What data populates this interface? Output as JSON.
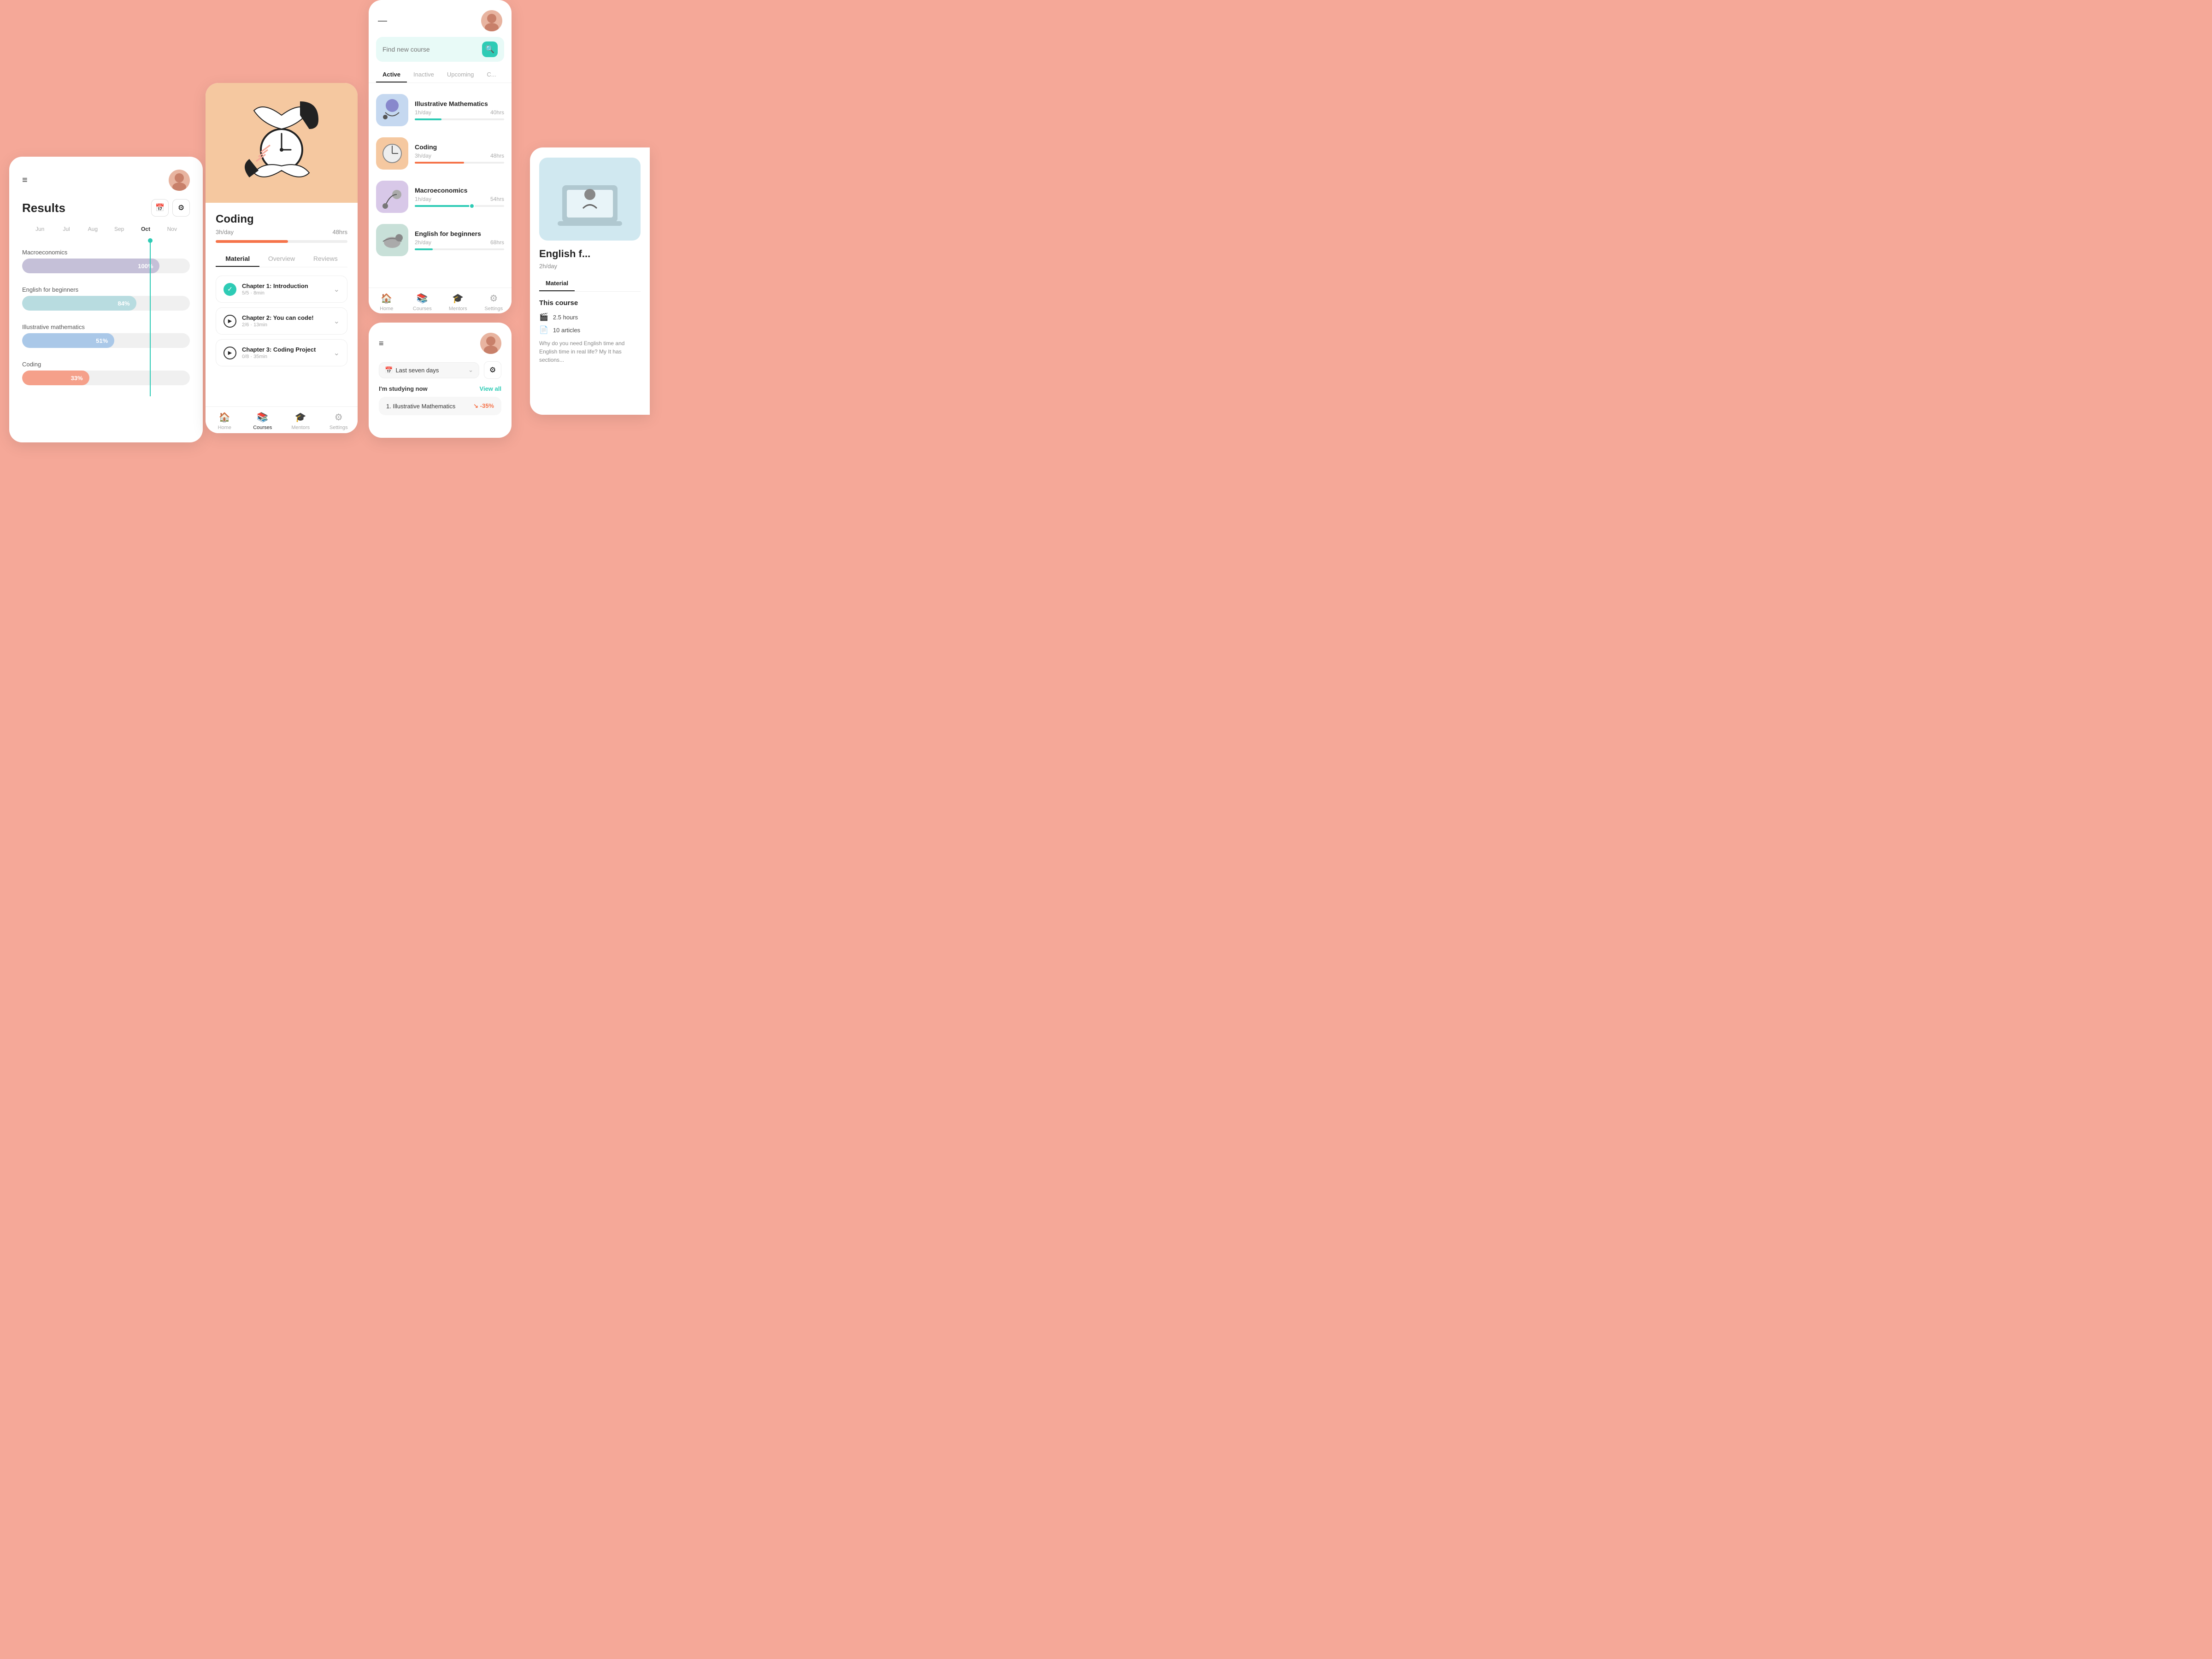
{
  "cards": {
    "results": {
      "title": "Results",
      "months": [
        "Jun",
        "Jul",
        "Aug",
        "Sep",
        "Oct",
        "Nov"
      ],
      "active_month": "Oct",
      "bars": [
        {
          "label": "Macroeconomics",
          "pct": "100%",
          "width": 82,
          "color": "#c5c0d8"
        },
        {
          "label": "English for beginners",
          "pct": "84%",
          "width": 68,
          "color": "#b8dce0"
        },
        {
          "label": "Illustrative mathematics",
          "pct": "51%",
          "width": 55,
          "color": "#aac8e8"
        },
        {
          "label": "Coding",
          "pct": "33%",
          "width": 40,
          "color": "#f5a08a"
        }
      ],
      "calendar_icon": "📅",
      "filter_icon": "⚙"
    },
    "coding": {
      "title": "Coding",
      "pace": "3h/day",
      "total": "48hrs",
      "progress_pct": 55,
      "tabs": [
        "Material",
        "Overview",
        "Reviews"
      ],
      "active_tab": "Material",
      "chapters": [
        {
          "name": "Chapter 1: Introduction",
          "sub": "5/5 · 8min",
          "done": true
        },
        {
          "name": "Chapter 2: You can code!",
          "sub": "2/6 · 13min",
          "done": false
        },
        {
          "name": "Chapter 3: Coding Project",
          "sub": "0/8 · 35min",
          "done": false
        }
      ],
      "nav_items": [
        {
          "label": "Home",
          "icon": "🏠",
          "active": false
        },
        {
          "label": "Courses",
          "icon": "📚",
          "active": true
        },
        {
          "label": "Mentors",
          "icon": "🎓",
          "active": false
        },
        {
          "label": "Settings",
          "icon": "⚙",
          "active": false
        }
      ]
    },
    "courses": {
      "search_placeholder": "Find new course",
      "tabs": [
        "Active",
        "Inactive",
        "Upcoming",
        "C..."
      ],
      "active_tab": "Active",
      "items": [
        {
          "name": "Illustrative Mathematics",
          "pace": "1h/day",
          "total": "40hrs",
          "prog": 30,
          "color": "#2ecbb5",
          "thumb_class": "course-thumb-illu"
        },
        {
          "name": "Coding",
          "pace": "3h/day",
          "total": "48hrs",
          "prog": 55,
          "color": "#f5734a",
          "thumb_class": "course-thumb-coding"
        },
        {
          "name": "Macroeconomics",
          "pace": "1h/day",
          "total": "54hrs",
          "prog": 65,
          "color": "#2ecbb5",
          "thumb_class": "course-thumb-macro"
        },
        {
          "name": "English for beginners",
          "pace": "2h/day",
          "total": "68hrs",
          "prog": 20,
          "color": "#2ecbb5",
          "thumb_class": "course-thumb-english"
        }
      ],
      "nav_items": [
        {
          "label": "Home",
          "icon": "🏠",
          "active": false
        },
        {
          "label": "Courses",
          "icon": "📚",
          "active": false
        },
        {
          "label": "Mentors",
          "icon": "🎓",
          "active": false
        },
        {
          "label": "Settings",
          "icon": "⚙",
          "active": false
        }
      ]
    },
    "studying": {
      "header_icon": "≡",
      "filter_label": "Last seven days",
      "studying_now_label": "I'm studying now",
      "view_all": "View all",
      "item_name": "1. Illustrative Mathematics",
      "item_pct": "↘ -35%"
    },
    "english": {
      "title": "English f...",
      "full_title": "English for beginners",
      "pace": "2h/day",
      "tab_active": "Material",
      "this_course": "This course",
      "stat_hours": "2.5 hours",
      "stat_articles": "10 articles",
      "desc": "Why do you need English time and English time in real life? My It has sections..."
    }
  }
}
